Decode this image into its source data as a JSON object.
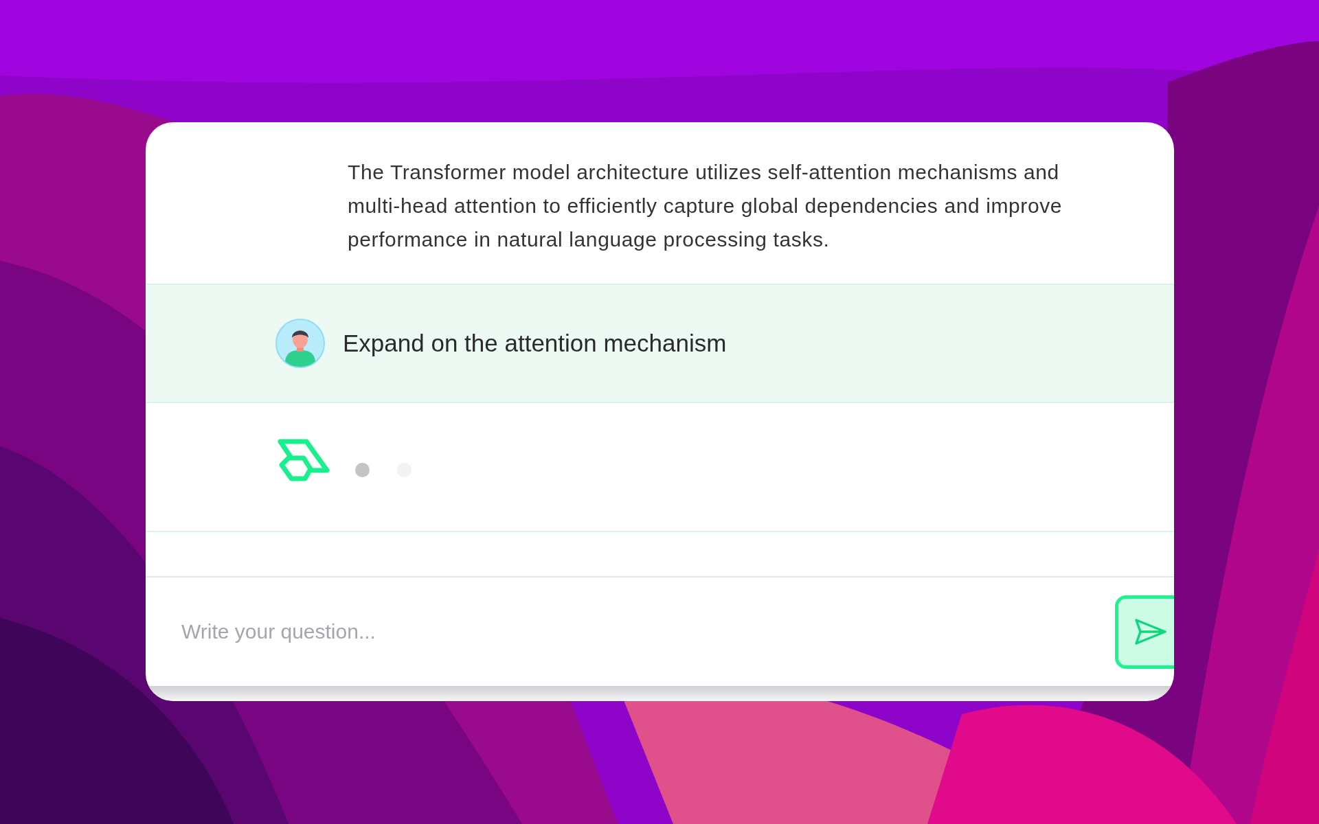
{
  "chat": {
    "messages": [
      {
        "kind": "answer",
        "text": "The Transformer model architecture utilizes self-attention mechanisms and multi-head attention to efficiently capture global dependencies and improve performance in natural language processing tasks."
      },
      {
        "kind": "question",
        "text": "Expand on the attention mechanism"
      },
      {
        "kind": "typing"
      }
    ]
  },
  "composer": {
    "placeholder": "Write your question..."
  }
}
